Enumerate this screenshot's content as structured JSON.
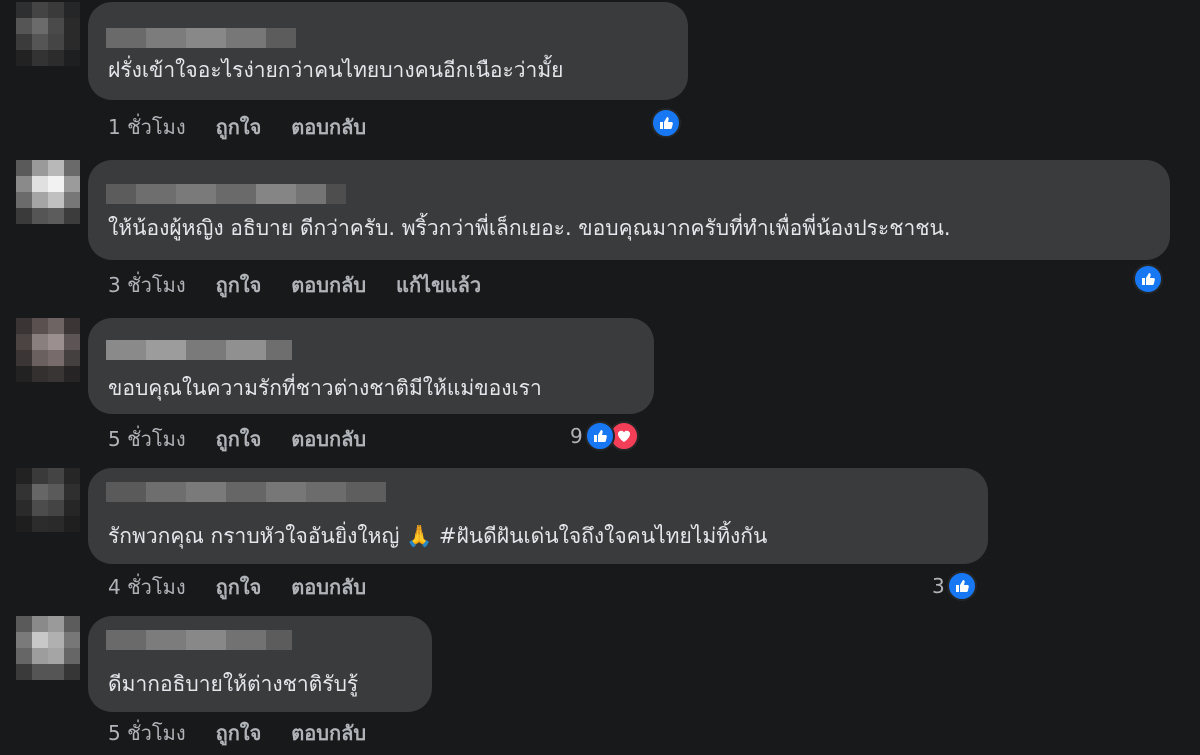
{
  "colors": {
    "background": "#18191a",
    "bubble": "#3a3b3c",
    "text": "#e4e6eb",
    "meta": "#b0b3b8",
    "like": "#1877f2",
    "love": "#f33e58"
  },
  "comments": [
    {
      "text": "ฝรั่งเข้าใจอะไรง่ายกว่าคนไทยบางคนอีกเนือะว่ามั้ย",
      "time": "1 ชั่วโมง",
      "like": "ถูกใจ",
      "reply": "ตอบกลับ",
      "reactions": [
        "like-icon"
      ],
      "reaction_count": ""
    },
    {
      "text": "ให้น้องผู้หญิง อธิบาย ดีกว่าครับ. พริ้วกว่าพี่เล็กเยอะ. ขอบคุณมากครับที่ทำเพื่อพี่น้องประชาชน.",
      "time": "3 ชั่วโมง",
      "like": "ถูกใจ",
      "reply": "ตอบกลับ",
      "edited": "แก้ไขแล้ว",
      "reactions": [
        "like-icon"
      ],
      "reaction_count": ""
    },
    {
      "text": "ขอบคุณในความรักที่ชาวต่างชาติมีให้แม่ของเรา",
      "time": "5 ชั่วโมง",
      "like": "ถูกใจ",
      "reply": "ตอบกลับ",
      "reactions": [
        "like-icon",
        "heart-icon"
      ],
      "reaction_count": "9"
    },
    {
      "text": "รักพวกคุณ กราบหัวใจอันยิ่งใหญ่ 🙏 #ฝันดีฝันเด่นใจถึงใจคนไทยไม่ทิ้งกัน",
      "time": "4 ชั่วโมง",
      "like": "ถูกใจ",
      "reply": "ตอบกลับ",
      "reactions": [
        "like-icon"
      ],
      "reaction_count": "3"
    },
    {
      "text": "ดีมากอธิบายให้ต่างชาติรับรู้",
      "time": "5 ชั่วโมง",
      "like": "ถูกใจ",
      "reply": "ตอบกลับ",
      "reactions": [],
      "reaction_count": ""
    }
  ]
}
